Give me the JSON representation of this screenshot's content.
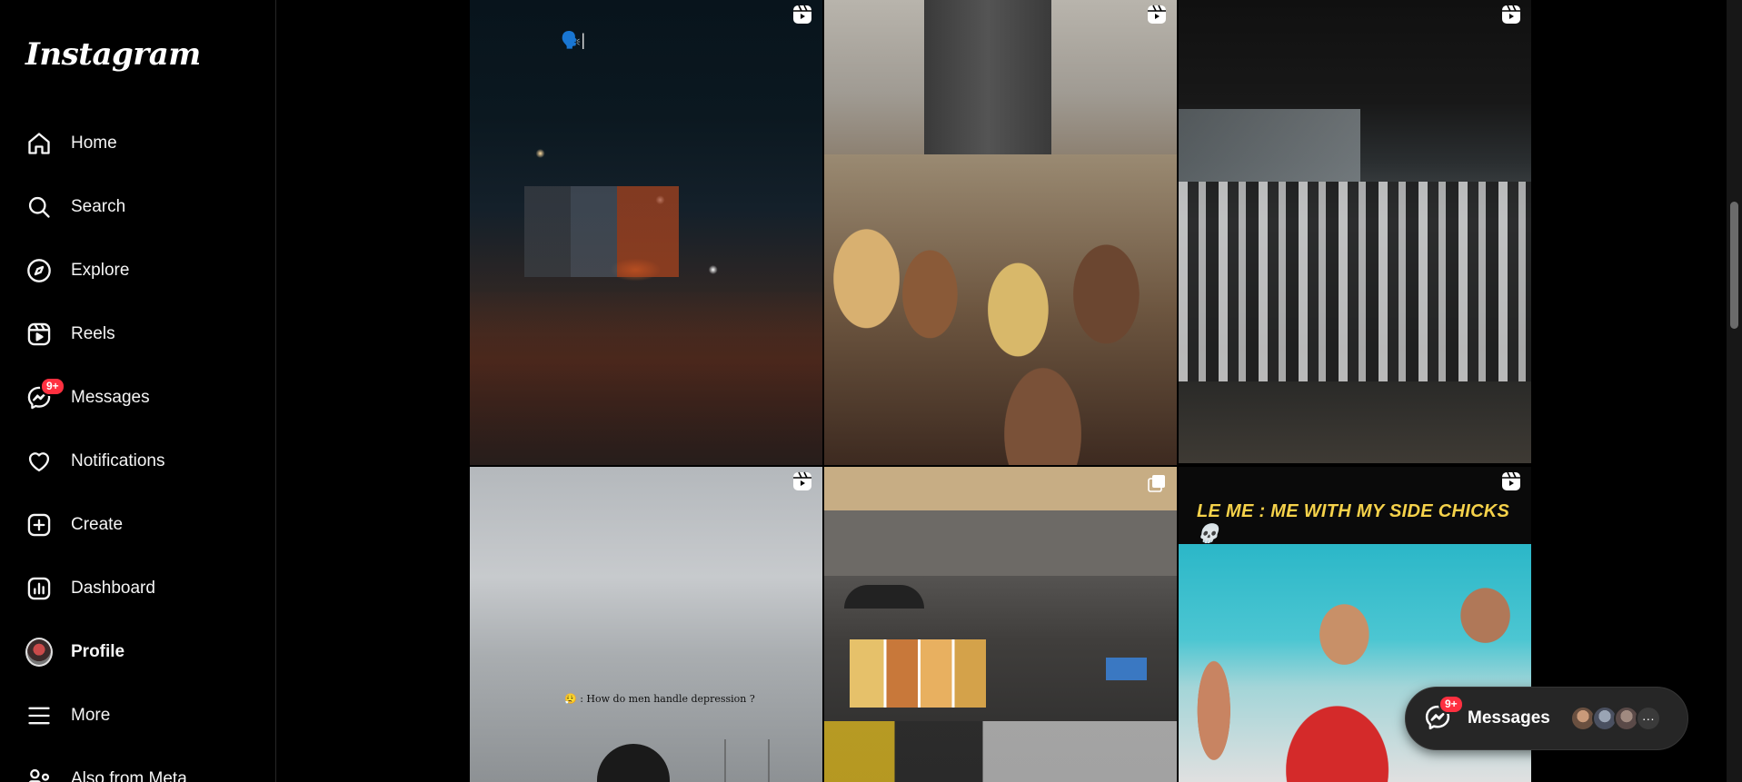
{
  "app": {
    "logo": "Instagram"
  },
  "sidebar": {
    "items": [
      {
        "label": "Home",
        "icon": "home-icon"
      },
      {
        "label": "Search",
        "icon": "search-icon"
      },
      {
        "label": "Explore",
        "icon": "compass-icon"
      },
      {
        "label": "Reels",
        "icon": "reels-icon"
      },
      {
        "label": "Messages",
        "icon": "messenger-icon",
        "badge": "9+"
      },
      {
        "label": "Notifications",
        "icon": "heart-icon"
      },
      {
        "label": "Create",
        "icon": "plus-square-icon"
      },
      {
        "label": "Dashboard",
        "icon": "bar-chart-icon"
      },
      {
        "label": "Profile",
        "icon": "avatar"
      },
      {
        "label": "More",
        "icon": "hamburger-icon"
      },
      {
        "label": "Also from Meta",
        "icon": "meta-icon"
      }
    ]
  },
  "grid": {
    "posts": [
      {
        "type": "reel",
        "caption": "🗣️|"
      },
      {
        "type": "reel"
      },
      {
        "type": "reel"
      },
      {
        "type": "reel",
        "caption": "😮‍💨 : How do men handle depression ?"
      },
      {
        "type": "carousel"
      },
      {
        "type": "reel",
        "caption": "LE ME : ME WITH MY SIDE CHICKS 💀"
      }
    ]
  },
  "messages_pill": {
    "label": "Messages",
    "badge": "9+",
    "more": "···"
  },
  "colors": {
    "background": "#000000",
    "badge": "#ff3040",
    "pill": "#262626",
    "banner_text": "#f6d24a"
  }
}
